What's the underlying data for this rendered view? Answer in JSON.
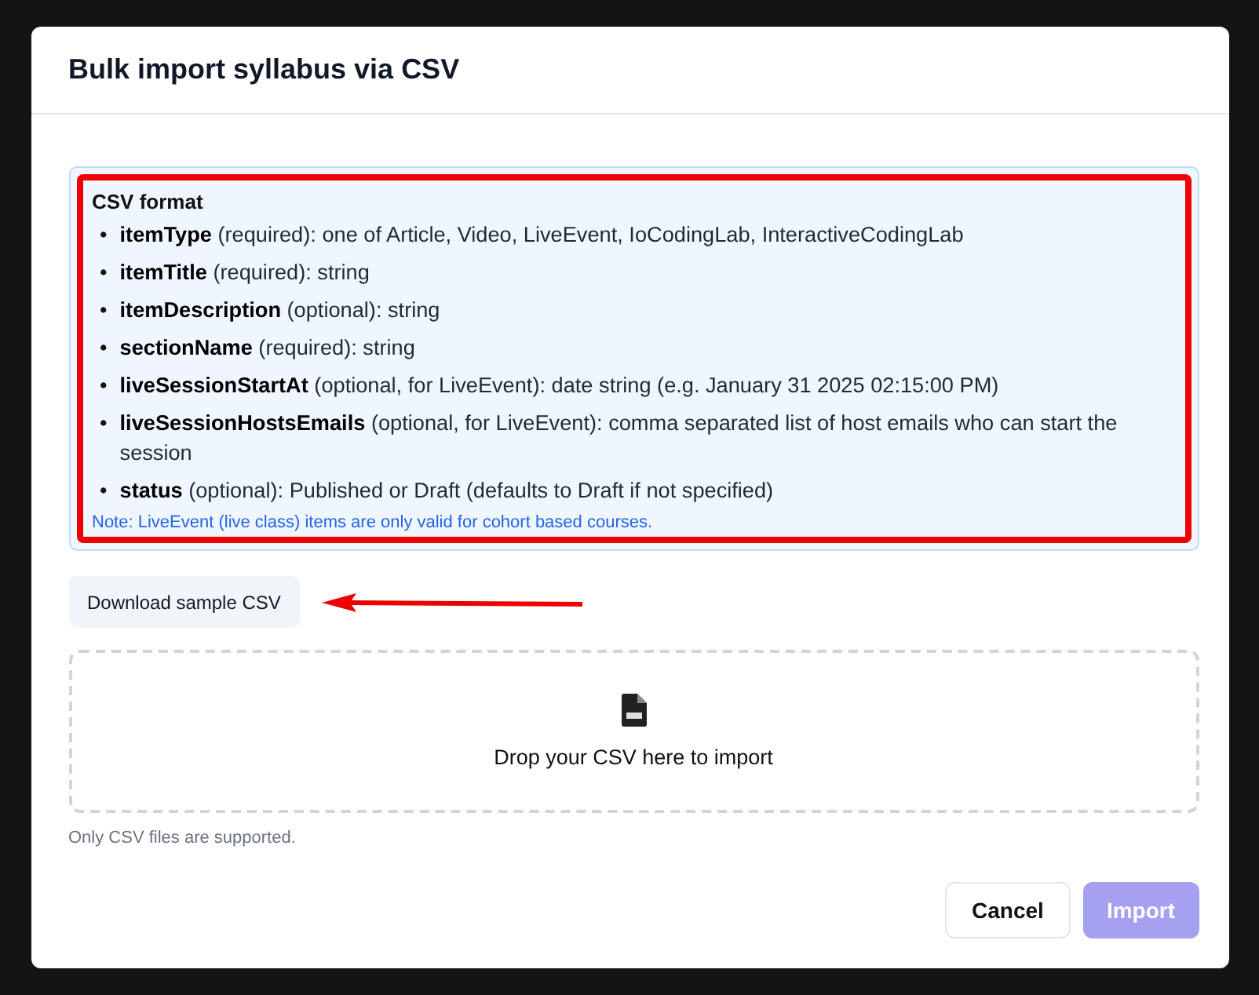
{
  "dialog": {
    "title": "Bulk import syllabus via CSV"
  },
  "csv_format": {
    "heading": "CSV format",
    "highlighted": true,
    "bullet": "•",
    "fields": [
      "**itemType** (required): one of Article, Video, LiveEvent, IoCodingLab, InteractiveCodingLab",
      "**itemTitle** (required): string",
      "**itemDescription** (optional): string",
      "**sectionName** (required): string",
      "**liveSessionStartAt** (optional, for LiveEvent): date string (e.g. January 31 2025 02:15:00 PM)",
      "**liveSessionHostsEmails** (optional, for LiveEvent): comma separated list of host emails who can start the session",
      "**status** (optional): Published or Draft (defaults to Draft if not specified)"
    ],
    "note": "Note: LiveEvent (live class) items are only valid for cohort based courses."
  },
  "download_button": {
    "label": "Download sample CSV",
    "annotated": true
  },
  "dropzone": {
    "label": "Drop your CSV here to import"
  },
  "hint": "Only CSV files are supported.",
  "buttons": [
    {
      "label": "Cancel",
      "kind": "secondary",
      "disabled": false
    },
    {
      "label": "Import",
      "kind": "primary",
      "disabled": true
    }
  ]
}
